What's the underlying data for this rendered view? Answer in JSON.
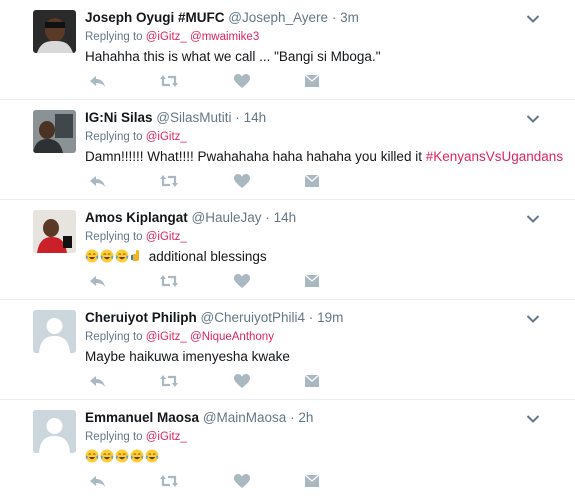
{
  "tweets": [
    {
      "fullname": "Joseph Oyugi #MUFC",
      "handle": "@Joseph_Ayere",
      "time": "3m",
      "replying_prefix": "Replying to",
      "replying_to": [
        "@iGitz_",
        "@mwaimike3"
      ],
      "text": "Hahahha this is what we call ... \"Bangi si  Mboga.\"",
      "hashtag": "",
      "emojis": [],
      "avatar_kind": "photo-dark"
    },
    {
      "fullname": "IG:Ni Silas",
      "handle": "@SilasMutiti",
      "time": "14h",
      "replying_prefix": "Replying to",
      "replying_to": [
        "@iGitz_"
      ],
      "text": "Damn!!!!!! What!!!! Pwahahaha haha hahaha you killed it ",
      "hashtag": "#KenyansVsUgandans",
      "emojis": [],
      "avatar_kind": "photo-gray"
    },
    {
      "fullname": "Amos Kiplangat",
      "handle": "@HauleJay",
      "time": "14h",
      "replying_prefix": "Replying to",
      "replying_to": [
        "@iGitz_"
      ],
      "text": "additional blessings",
      "hashtag": "",
      "emojis": [
        "face-with-tears-of-joy",
        "face-with-tears-of-joy",
        "face-with-tears-of-joy",
        "backhand-index-pointing-right"
      ],
      "avatar_kind": "photo-red"
    },
    {
      "fullname": "Cheruiyot Philiph",
      "handle": "@CheruiyotPhili4",
      "time": "19m",
      "replying_prefix": "Replying to",
      "replying_to": [
        "@iGitz_",
        "@NiqueAnthony"
      ],
      "text": "Maybe haikuwa imenyesha kwake",
      "hashtag": "",
      "emojis": [],
      "avatar_kind": "default"
    },
    {
      "fullname": "Emmanuel Maosa",
      "handle": "@MainMaosa",
      "time": "2h",
      "replying_prefix": "Replying to",
      "replying_to": [
        "@iGitz_"
      ],
      "text": "",
      "hashtag": "",
      "emojis": [
        "face-with-tears-of-joy",
        "face-with-tears-of-joy",
        "face-with-tears-of-joy",
        "face-with-tears-of-joy",
        "face-with-tears-of-joy"
      ],
      "avatar_kind": "default"
    }
  ],
  "separator": "·",
  "icons": {
    "reply": "reply-icon",
    "retweet": "retweet-icon",
    "like": "like-icon",
    "dm": "direct-message-icon",
    "caret": "chevron-down-icon"
  },
  "colors": {
    "text": "#14171a",
    "secondary": "#657786",
    "link": "#e0245e",
    "icon": "#aab8c2",
    "border": "#e6ecf0"
  }
}
